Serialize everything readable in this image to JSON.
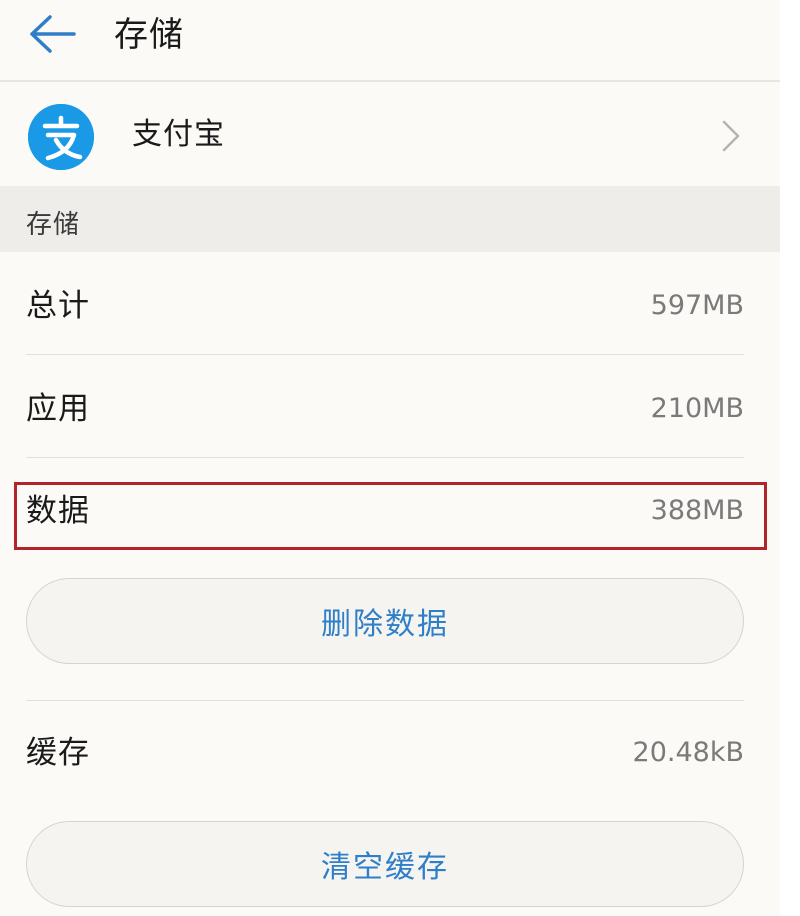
{
  "header": {
    "title": "存储"
  },
  "app": {
    "name": "支付宝",
    "logo_glyph": "支",
    "logo_color": "#1a9ae6"
  },
  "section": {
    "label": "存储"
  },
  "rows": {
    "total": {
      "label": "总计",
      "value": "597MB"
    },
    "app": {
      "label": "应用",
      "value": "210MB"
    },
    "data": {
      "label": "数据",
      "value": "388MB"
    },
    "cache": {
      "label": "缓存",
      "value": "20.48kB"
    }
  },
  "buttons": {
    "delete_data": "删除数据",
    "clear_cache": "清空缓存"
  },
  "colors": {
    "accent": "#2f7fc8",
    "highlight": "#b0242a"
  }
}
